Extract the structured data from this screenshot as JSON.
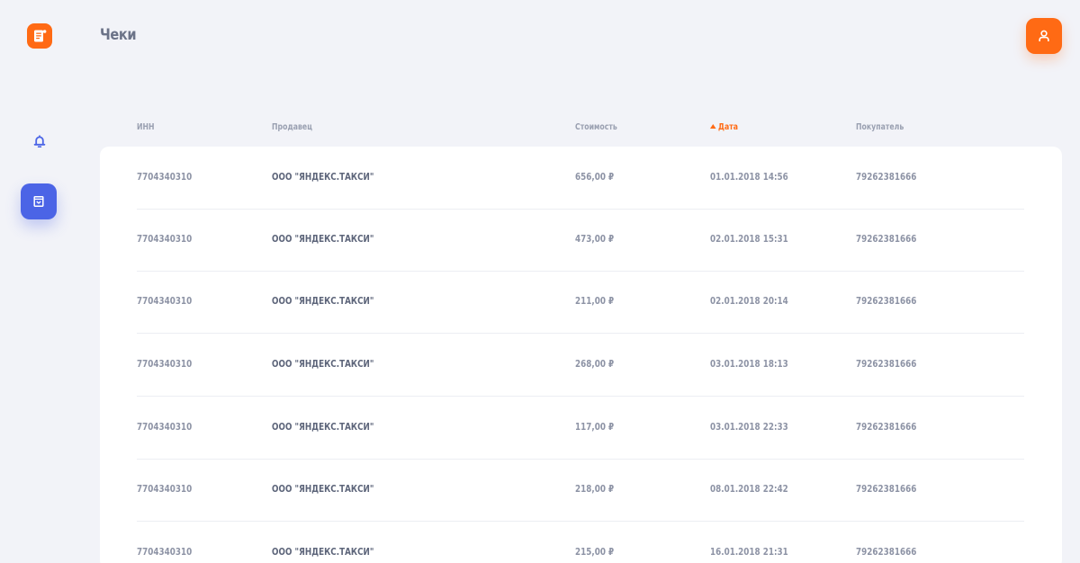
{
  "app": {
    "logo_icon": "receipt-logo-icon",
    "accent_color": "#ff6a14",
    "primary_color": "#4b64e6"
  },
  "header": {
    "title": "Чеки",
    "profile_icon": "user-icon"
  },
  "sidebar": {
    "items": [
      {
        "icon": "bell-icon",
        "active": false
      },
      {
        "icon": "receipt-icon",
        "active": true
      }
    ]
  },
  "table": {
    "columns": {
      "inn": "ИНН",
      "seller": "Продавец",
      "cost": "Стоимость",
      "date": "Дата",
      "buyer": "Покупатель"
    },
    "sort": {
      "column": "date",
      "direction": "asc"
    },
    "rows": [
      {
        "inn": "7704340310",
        "seller": "ООО \"ЯНДЕКС.ТАКСИ\"",
        "cost": "656,00 ₽",
        "date": "01.01.2018 14:56",
        "buyer": "79262381666"
      },
      {
        "inn": "7704340310",
        "seller": "ООО \"ЯНДЕКС.ТАКСИ\"",
        "cost": "473,00 ₽",
        "date": "02.01.2018 15:31",
        "buyer": "79262381666"
      },
      {
        "inn": "7704340310",
        "seller": "ООО \"ЯНДЕКС.ТАКСИ\"",
        "cost": "211,00 ₽",
        "date": "02.01.2018 20:14",
        "buyer": "79262381666"
      },
      {
        "inn": "7704340310",
        "seller": "ООО \"ЯНДЕКС.ТАКСИ\"",
        "cost": "268,00 ₽",
        "date": "03.01.2018 18:13",
        "buyer": "79262381666"
      },
      {
        "inn": "7704340310",
        "seller": "ООО \"ЯНДЕКС.ТАКСИ\"",
        "cost": "117,00 ₽",
        "date": "03.01.2018 22:33",
        "buyer": "79262381666"
      },
      {
        "inn": "7704340310",
        "seller": "ООО \"ЯНДЕКС.ТАКСИ\"",
        "cost": "218,00 ₽",
        "date": "08.01.2018 22:42",
        "buyer": "79262381666"
      },
      {
        "inn": "7704340310",
        "seller": "ООО \"ЯНДЕКС.ТАКСИ\"",
        "cost": "215,00 ₽",
        "date": "16.01.2018 21:31",
        "buyer": "79262381666"
      }
    ]
  }
}
